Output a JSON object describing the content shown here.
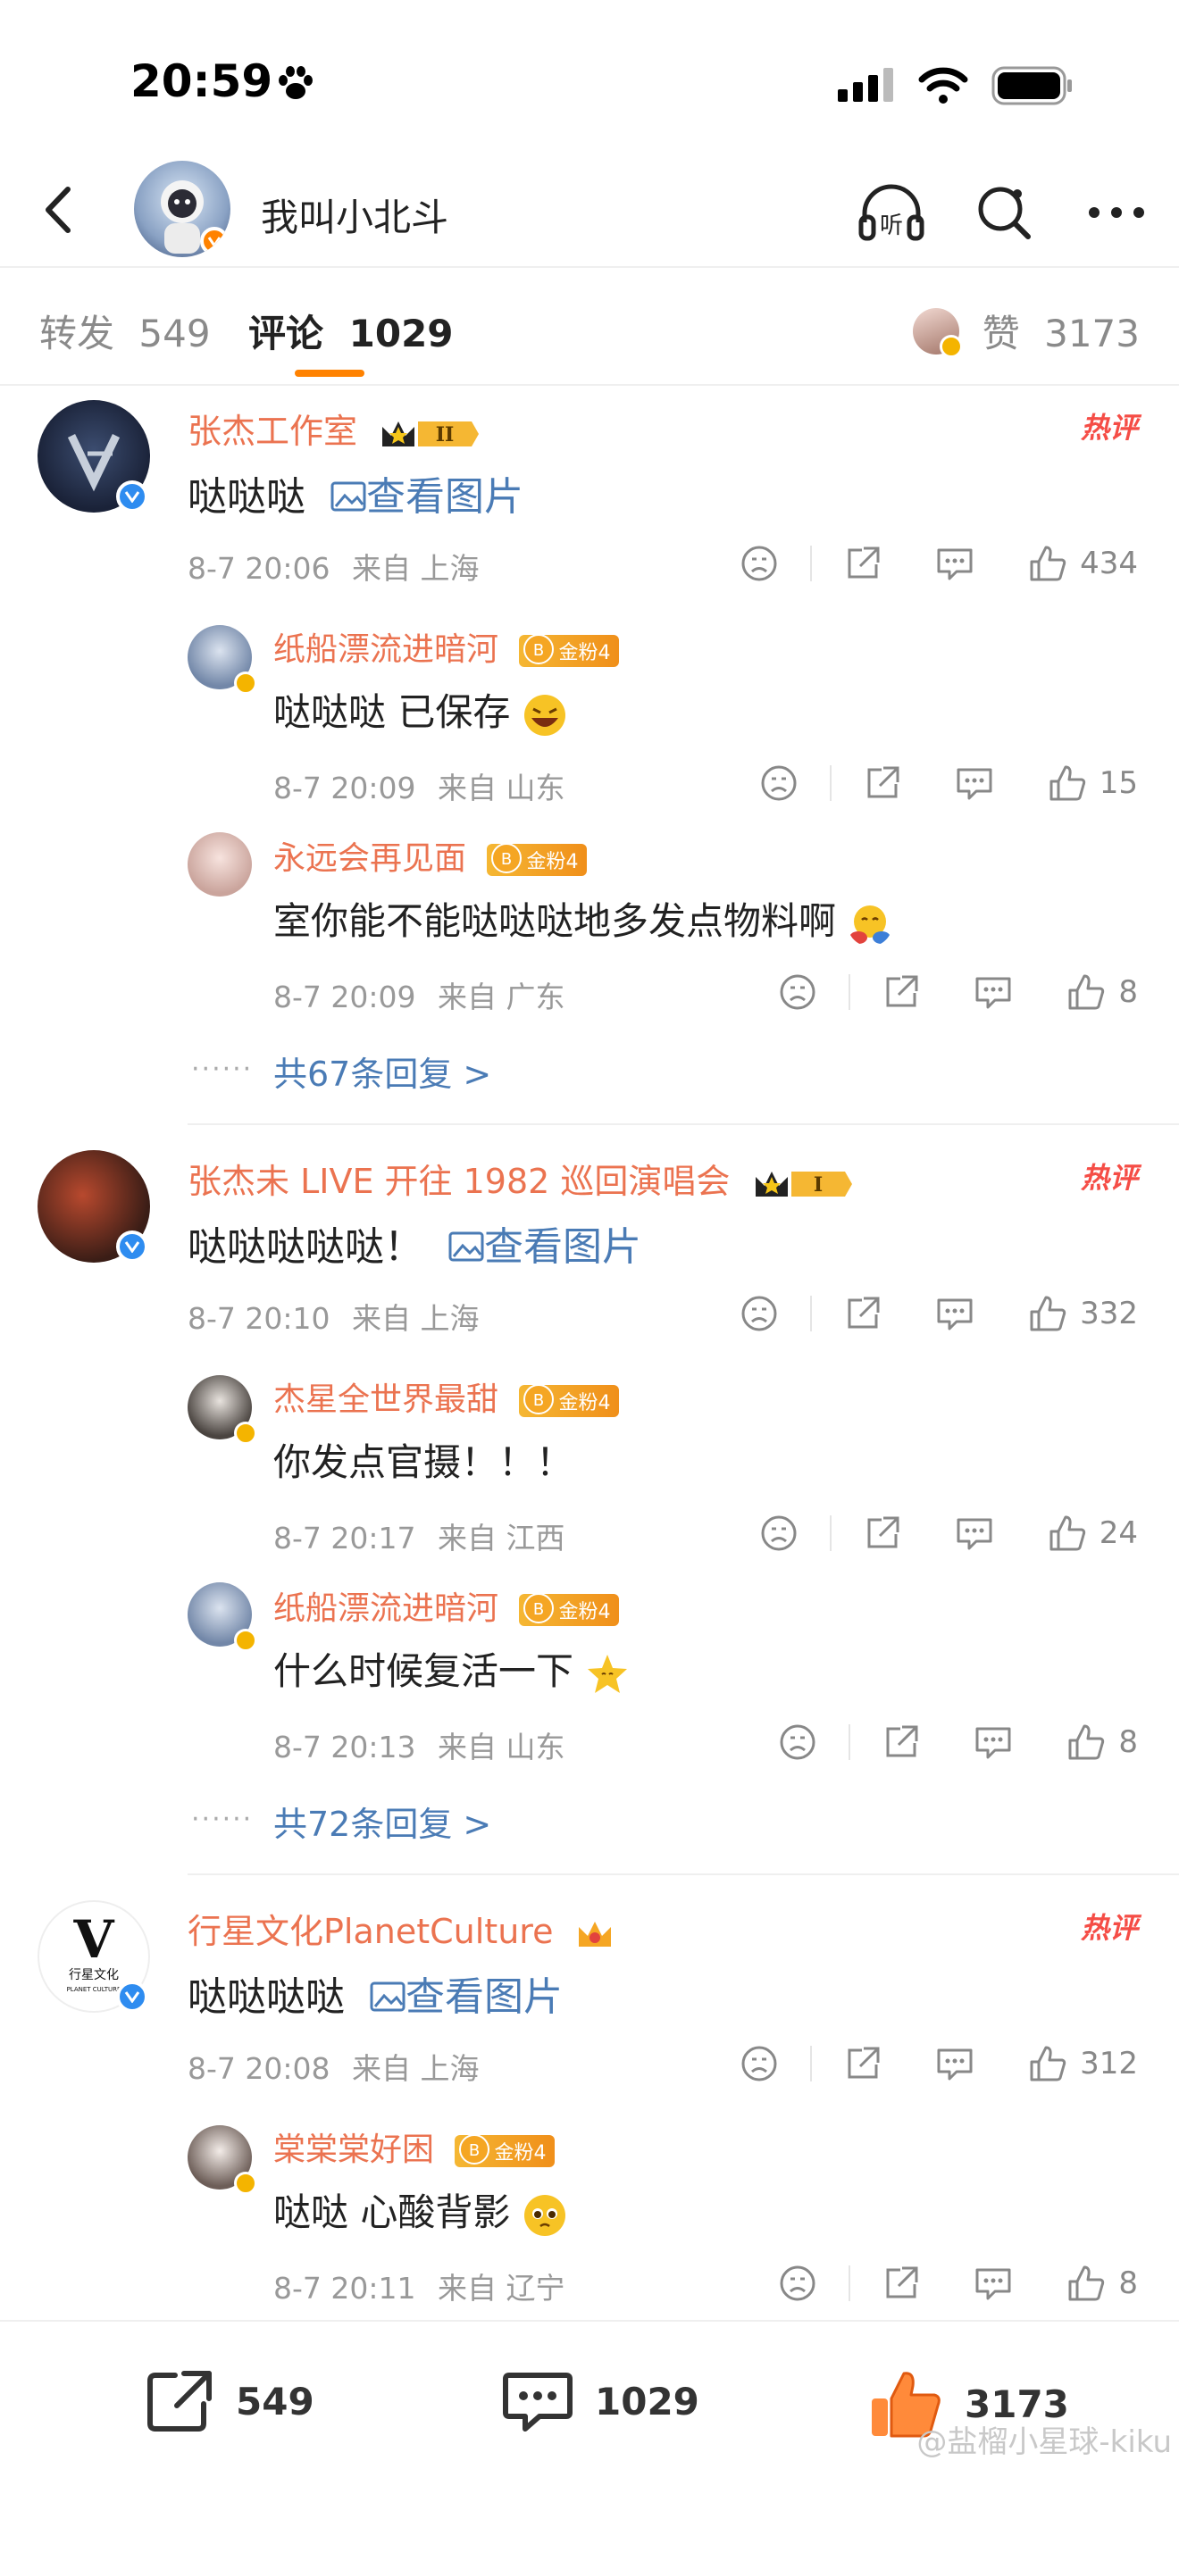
{
  "status_bar": {
    "time": "20:59"
  },
  "nav": {
    "title": "我叫小北斗"
  },
  "tabs": {
    "repost_label": "转发",
    "repost_count": "549",
    "comment_label": "评论",
    "comment_count": "1029",
    "like_label": "赞",
    "like_count": "3173"
  },
  "hot_label": "热评",
  "comments": [
    {
      "name": "张杰工作室",
      "crown_level": "II",
      "text": "哒哒哒",
      "link": "查看图片",
      "time": "8-7 20:06",
      "location": "来自 上海",
      "likes": "434",
      "replies": [
        {
          "name": "纸船漂流进暗河",
          "fan_badge": "金粉4",
          "text": "哒哒哒 已保存",
          "time": "8-7 20:09",
          "location": "来自 山东",
          "likes": "15"
        },
        {
          "name": "永远会再见面",
          "fan_badge": "金粉4",
          "text": "室你能不能哒哒哒地多发点物料啊",
          "time": "8-7 20:09",
          "location": "来自 广东",
          "likes": "8"
        }
      ],
      "more": "共67条回复 >"
    },
    {
      "name": "张杰未 LIVE 开往 1982 巡回演唱会",
      "crown_level": "I",
      "text": "哒哒哒哒哒！",
      "link": "查看图片",
      "time": "8-7 20:10",
      "location": "来自 上海",
      "likes": "332",
      "replies": [
        {
          "name": "杰星全世界最甜",
          "fan_badge": "金粉4",
          "text": "你发点官摄！！！",
          "time": "8-7 20:17",
          "location": "来自 江西",
          "likes": "24"
        },
        {
          "name": "纸船漂流进暗河",
          "fan_badge": "金粉4",
          "text": "什么时候复活一下",
          "time": "8-7 20:13",
          "location": "来自 山东",
          "likes": "8"
        }
      ],
      "more": "共72条回复 >"
    },
    {
      "name": "行星文化PlanetCulture",
      "text": "哒哒哒哒",
      "link": "查看图片",
      "time": "8-7 20:08",
      "location": "来自 上海",
      "likes": "312",
      "logo_text": "行星文化",
      "logo_sub": "PLANET CULTURE",
      "replies": [
        {
          "name": "棠棠棠好困",
          "fan_badge": "金粉4",
          "text": "哒哒 心酸背影",
          "time": "8-7 20:11",
          "location": "来自 辽宁",
          "likes": "8"
        }
      ]
    }
  ],
  "bottom_bar": {
    "repost": "549",
    "comment": "1029",
    "like": "3173"
  },
  "watermark": "@盐榴小星球-kiku",
  "colors": {
    "accent": "#ff8200",
    "name": "#eb7350",
    "link": "#4a7bb5",
    "hot": "#f54d46"
  }
}
